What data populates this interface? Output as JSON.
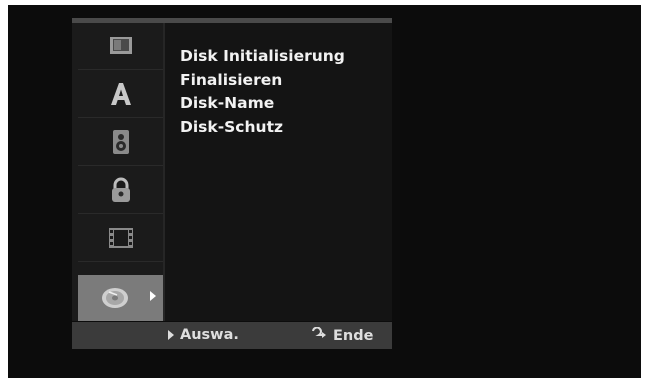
{
  "menu": {
    "items": [
      {
        "label": "Disk Initialisierung"
      },
      {
        "label": "Finalisieren"
      },
      {
        "label": "Disk-Name"
      },
      {
        "label": "Disk-Schutz"
      }
    ]
  },
  "sidebar": {
    "items": [
      {
        "icon": "tv-screen-icon",
        "selected": false
      },
      {
        "icon": "language-a-icon",
        "selected": false
      },
      {
        "icon": "speaker-icon",
        "selected": false
      },
      {
        "icon": "lock-icon",
        "selected": false
      },
      {
        "icon": "film-strip-icon",
        "selected": false
      },
      {
        "icon": "disc-icon",
        "selected": true
      }
    ]
  },
  "footer": {
    "select_label": "Auswa.",
    "end_label": "Ende"
  },
  "colors": {
    "background": "#0c0c0c",
    "panel": "#141414",
    "selected_tab": "#7b7b7b",
    "bottom_bar": "#3b3b3b",
    "text": "#f2f2f2"
  }
}
